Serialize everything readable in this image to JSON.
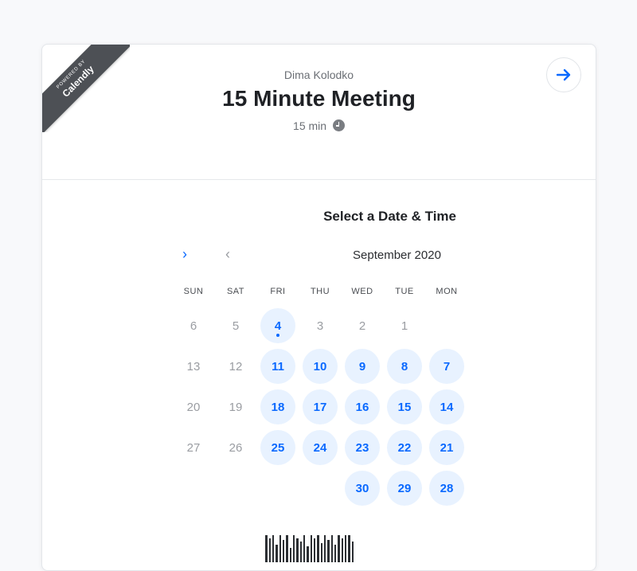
{
  "branding": {
    "powered_by": "POWERED BY",
    "name": "Calendly"
  },
  "event": {
    "host": "Dima Kolodko",
    "title": "15 Minute Meeting",
    "duration": "15 min"
  },
  "scheduler": {
    "heading": "Select a Date & Time",
    "month": "September 2020",
    "days_of_week": [
      "MON",
      "TUE",
      "WED",
      "THU",
      "FRI",
      "SAT",
      "SUN"
    ]
  },
  "calendar": {
    "weeks": [
      [
        null,
        {
          "d": "1"
        },
        {
          "d": "2"
        },
        {
          "d": "3"
        },
        {
          "d": "4",
          "avail": true,
          "today": true
        },
        {
          "d": "5"
        },
        {
          "d": "6"
        }
      ],
      [
        {
          "d": "7",
          "avail": true
        },
        {
          "d": "8",
          "avail": true
        },
        {
          "d": "9",
          "avail": true
        },
        {
          "d": "10",
          "avail": true
        },
        {
          "d": "11",
          "avail": true
        },
        {
          "d": "12"
        },
        {
          "d": "13"
        }
      ],
      [
        {
          "d": "14",
          "avail": true
        },
        {
          "d": "15",
          "avail": true
        },
        {
          "d": "16",
          "avail": true
        },
        {
          "d": "17",
          "avail": true
        },
        {
          "d": "18",
          "avail": true
        },
        {
          "d": "19"
        },
        {
          "d": "20"
        }
      ],
      [
        {
          "d": "21",
          "avail": true
        },
        {
          "d": "22",
          "avail": true
        },
        {
          "d": "23",
          "avail": true
        },
        {
          "d": "24",
          "avail": true
        },
        {
          "d": "25",
          "avail": true
        },
        {
          "d": "26"
        },
        {
          "d": "27"
        }
      ],
      [
        {
          "d": "28",
          "avail": true
        },
        {
          "d": "29",
          "avail": true
        },
        {
          "d": "30",
          "avail": true
        },
        null,
        null,
        null,
        null
      ]
    ]
  },
  "colors": {
    "accent": "#0a69ff",
    "available_bg": "#e8f2ff",
    "ribbon": "#4d5055"
  }
}
